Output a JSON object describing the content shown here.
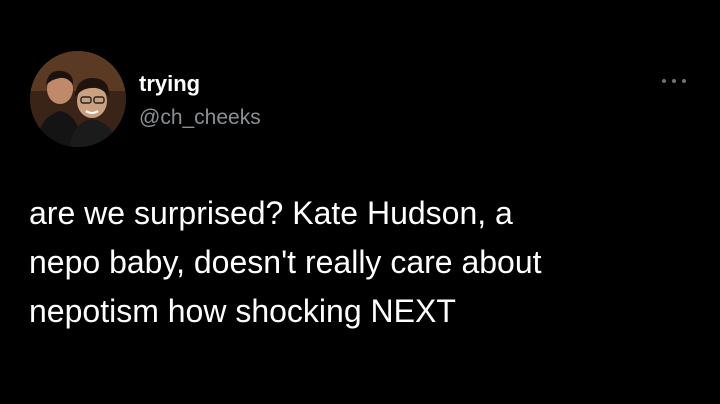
{
  "tweet": {
    "display_name": "trying",
    "handle": "@ch_cheeks",
    "text": "are we surprised? Kate Hudson, a\nnepo baby, doesn't really care about\nnepotism how shocking NEXT",
    "avatar_icon": "profile-photo-icon",
    "more_icon": "more-options-icon"
  },
  "colors": {
    "background": "#000000",
    "text_primary": "#ffffff",
    "text_secondary": "#8b8f94"
  }
}
